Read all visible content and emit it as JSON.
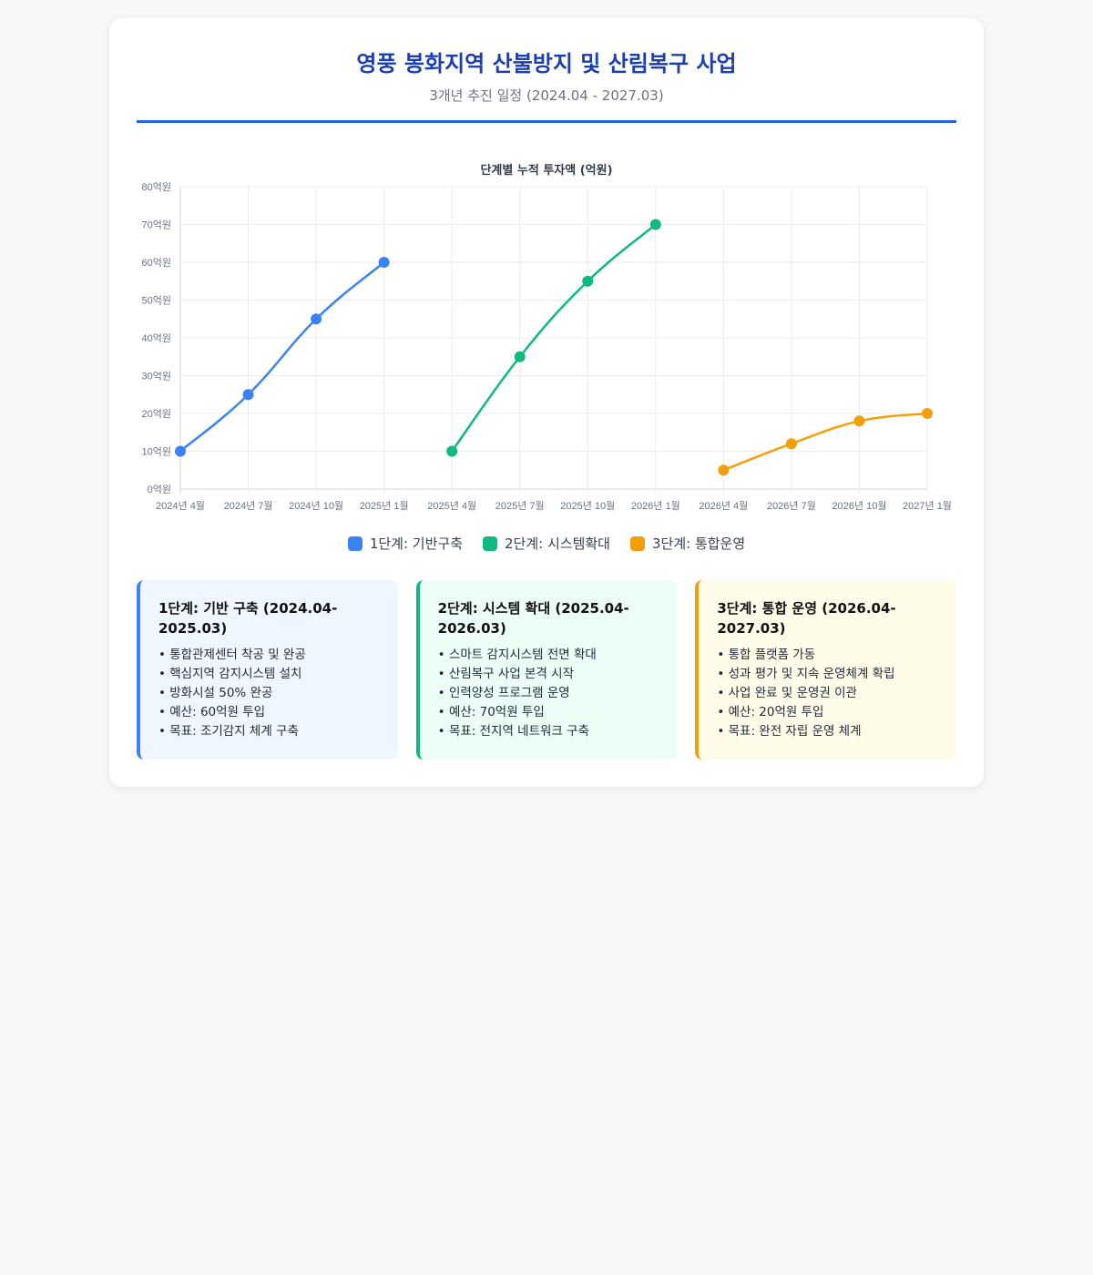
{
  "header": {
    "title": "영풍 봉화지역 산불방지 및 산림복구 사업",
    "subtitle": "3개년 추진 일정 (2024.04 - 2027.03)"
  },
  "chart_data": {
    "type": "line",
    "title": "단계별 누적 투자액 (억원)",
    "categories": [
      "2024년 4월",
      "2024년 7월",
      "2024년 10월",
      "2025년 1월",
      "2025년 4월",
      "2025년 7월",
      "2025년 10월",
      "2026년 1월",
      "2026년 4월",
      "2026년 7월",
      "2026년 10월",
      "2027년 1월"
    ],
    "y_ticks": [
      "0억원",
      "10억원",
      "20억원",
      "30억원",
      "40억원",
      "50억원",
      "60억원",
      "70억원",
      "80억원"
    ],
    "ylim": [
      0,
      80
    ],
    "grid": true,
    "legend_position": "bottom",
    "series": [
      {
        "name": "1단계: 기반구축",
        "color": "#3b82f6",
        "values": [
          10,
          25,
          45,
          60,
          null,
          null,
          null,
          null,
          null,
          null,
          null,
          null
        ]
      },
      {
        "name": "2단계: 시스템확대",
        "color": "#10b981",
        "values": [
          null,
          null,
          null,
          null,
          10,
          35,
          55,
          70,
          null,
          null,
          null,
          null
        ]
      },
      {
        "name": "3단계: 통합운영",
        "color": "#f59e0b",
        "values": [
          null,
          null,
          null,
          null,
          null,
          null,
          null,
          null,
          5,
          12,
          18,
          20
        ]
      }
    ]
  },
  "phases": [
    {
      "title": "1단계: 기반 구축 (2024.04-2025.03)",
      "bg": "#eff6ff",
      "border": "#3b82f6",
      "items": [
        "통합관제센터 착공 및 완공",
        "핵심지역 감지시스템 설치",
        "방화시설 50% 완공",
        "예산: 60억원 투입",
        "목표: 조기감지 체계 구축"
      ]
    },
    {
      "title": "2단계: 시스템 확대 (2025.04-2026.03)",
      "bg": "#ecfdf5",
      "border": "#10b981",
      "items": [
        "스마트 감지시스템 전면 확대",
        "산림복구 사업 본격 시작",
        "인력양성 프로그램 운영",
        "예산: 70억원 투입",
        "목표: 전지역 네트워크 구축"
      ]
    },
    {
      "title": "3단계: 통합 운영 (2026.04-2027.03)",
      "bg": "#fefce8",
      "border": "#f59e0b",
      "items": [
        "통합 플랫폼 가동",
        "성과 평가 및 지속 운영체계 확립",
        "사업 완료 및 운영권 이관",
        "예산: 20억원 투입",
        "목표: 완전 자립 운영 체계"
      ]
    }
  ]
}
